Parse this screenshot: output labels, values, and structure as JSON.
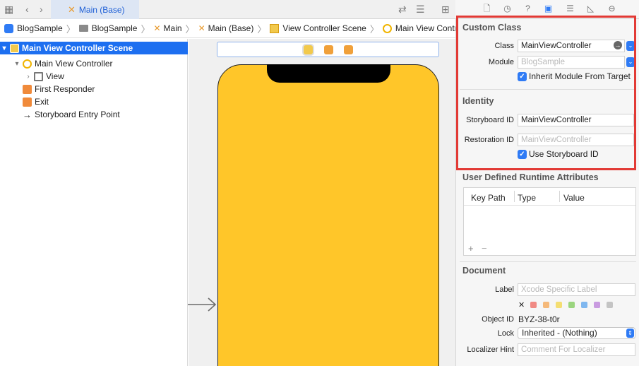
{
  "editor_tab": {
    "label": "Main (Base)"
  },
  "breadcrumb": [
    "BlogSample",
    "BlogSample",
    "Main",
    "Main (Base)",
    "View Controller Scene",
    "Main View Controller"
  ],
  "outline": {
    "scene": "Main View Controller Scene",
    "controller": "Main View Controller",
    "view": "View",
    "first_responder": "First Responder",
    "exit": "Exit",
    "entry_point": "Storyboard Entry Point"
  },
  "inspector": {
    "custom_class": {
      "title": "Custom Class",
      "class_label": "Class",
      "class_value": "MainViewController",
      "module_label": "Module",
      "module_placeholder": "BlogSample",
      "inherit_label": "Inherit Module From Target"
    },
    "identity": {
      "title": "Identity",
      "storyboard_id_label": "Storyboard ID",
      "storyboard_id_value": "MainViewController",
      "restoration_id_label": "Restoration ID",
      "restoration_id_placeholder": "MainViewController",
      "use_storyboard_label": "Use Storyboard ID"
    },
    "runtime_attributes": {
      "title": "User Defined Runtime Attributes",
      "columns": [
        "Key Path",
        "Type",
        "Value"
      ],
      "add_symbol": "+",
      "remove_symbol": "−"
    },
    "document": {
      "title": "Document",
      "label_label": "Label",
      "label_placeholder": "Xcode Specific Label",
      "object_id_label": "Object ID",
      "object_id_value": "BYZ-38-t0r",
      "lock_label": "Lock",
      "lock_value": "Inherited - (Nothing)",
      "localizer_label": "Localizer Hint",
      "localizer_placeholder": "Comment For Localizer",
      "clear_symbol": "✕"
    }
  },
  "colors": {
    "accent": "#1d6ff0",
    "highlight": "#e23a35",
    "phone_background": "#ffc629",
    "label_swatches": [
      "#f08a84",
      "#f5b97a",
      "#f4de72",
      "#9bd57f",
      "#7fb7ef",
      "#c99be0",
      "#c4c4c4"
    ]
  }
}
